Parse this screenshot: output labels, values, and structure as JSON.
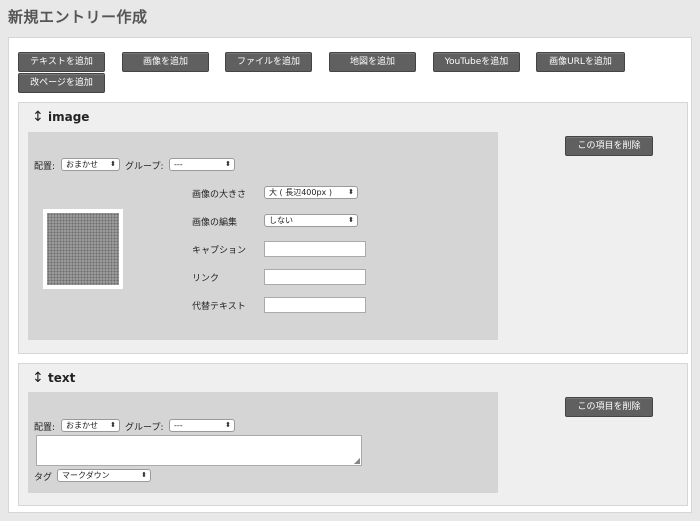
{
  "page": {
    "title": "新規エントリー作成"
  },
  "toolbar": {
    "add_text": "テキストを追加",
    "add_image": "画像を追加",
    "add_file": "ファイルを追加",
    "add_map": "地図を追加",
    "add_youtube": "YouTubeを追加",
    "add_image_url": "画像URLを追加",
    "add_page_break": "改ページを追加"
  },
  "image_entry": {
    "title": "image",
    "delete_label": "この項目を削除",
    "placement_label": "配置:",
    "placement_value": "おまかせ",
    "group_label": "グループ:",
    "group_value": "---",
    "size_label": "画像の大きさ",
    "size_value": "大 ( 長辺400px )",
    "edit_label": "画像の編集",
    "edit_value": "しない",
    "caption_label": "キャプション",
    "link_label": "リンク",
    "alt_label": "代替テキスト"
  },
  "text_entry": {
    "title": "text",
    "delete_label": "この項目を削除",
    "placement_label": "配置:",
    "placement_value": "おまかせ",
    "group_label": "グループ:",
    "group_value": "---",
    "tag_label": "タグ",
    "tag_value": "マークダウン"
  }
}
